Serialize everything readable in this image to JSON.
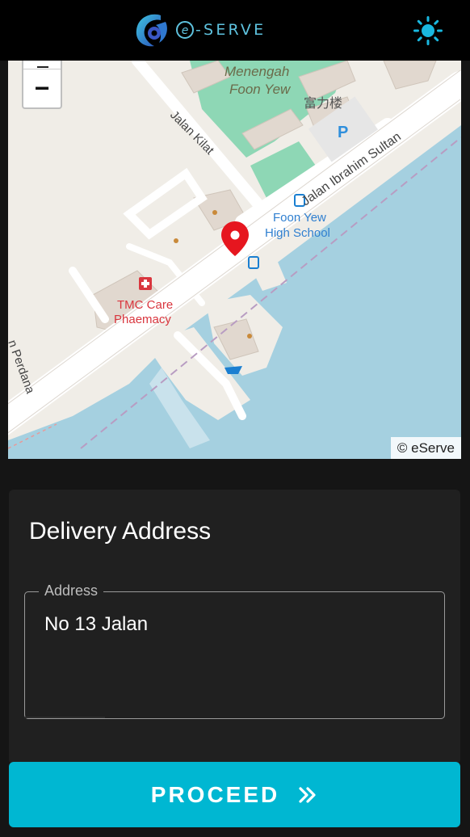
{
  "header": {
    "brand_text": "-SERVE",
    "brand_letter": "e",
    "logo_icon": "eserve-logo-icon",
    "theme_icon": "sun-icon",
    "accent_color": "#00b7d2"
  },
  "map": {
    "zoom_out_label": "−",
    "attribution": "© eServe",
    "labels": {
      "school_line1": "Menengah",
      "school_line2": "Foon Yew",
      "chinese_label": "富力楼",
      "street_kilat": "Jalan Kilat",
      "street_ibrahim": "Jalan Ibrahim Sultan",
      "high_school_line1": "Foon Yew",
      "high_school_line2": "High School",
      "pharmacy_line1": "TMC Care",
      "pharmacy_line2": "Phaemacy",
      "street_perdana": "n Perdana",
      "parking": "P"
    },
    "marker_icon": "map-pin-icon"
  },
  "delivery": {
    "title": "Delivery Address",
    "address_label": "Address",
    "address_value": "No 13 Jalan"
  },
  "actions": {
    "proceed_label": "PROCEED",
    "proceed_icon": "double-chevron-right-icon"
  }
}
